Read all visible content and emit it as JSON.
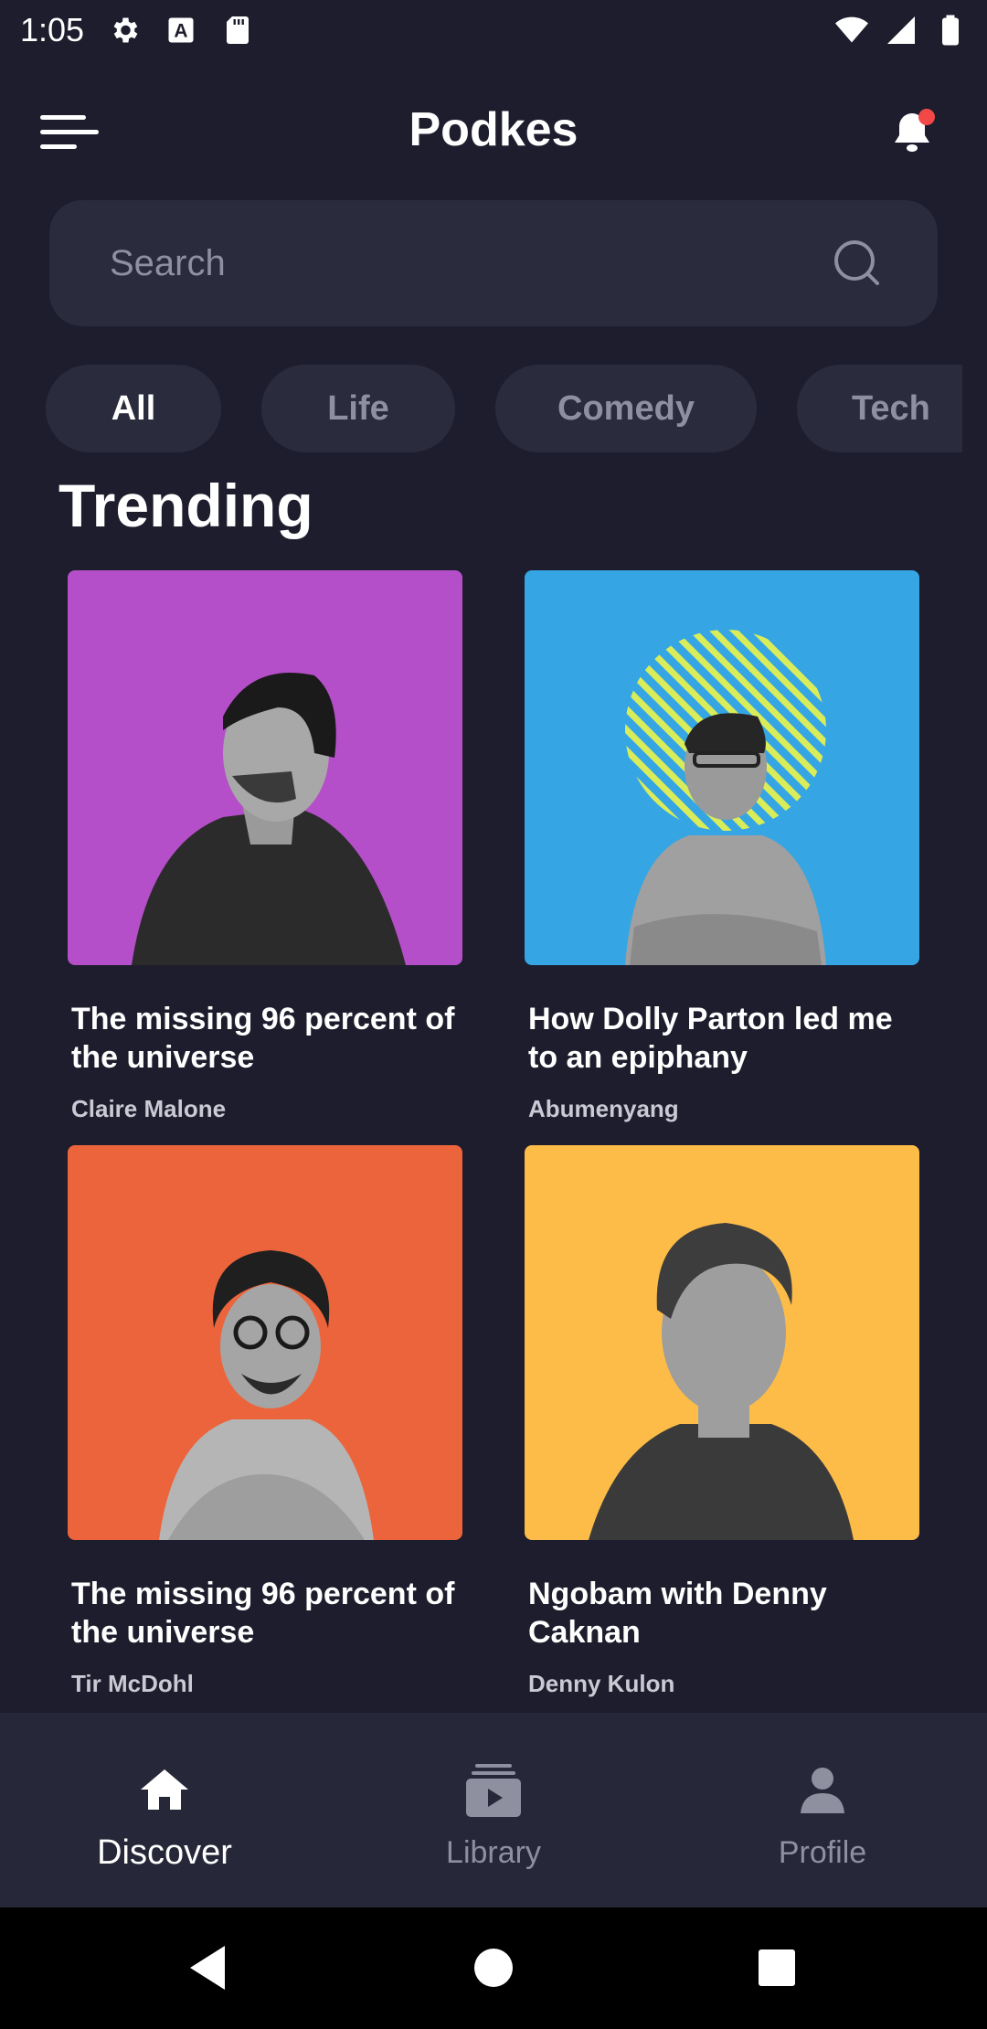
{
  "status_bar": {
    "time": "1:05",
    "icons_left": [
      "gear-icon",
      "a-badge-icon",
      "sd-card-icon"
    ],
    "icons_right": [
      "wifi-icon",
      "signal-icon",
      "battery-icon"
    ]
  },
  "header": {
    "title": "Podkes",
    "menu_icon": "menu-icon",
    "notification_icon": "bell-icon",
    "notification_badge_color": "#f24848"
  },
  "search": {
    "placeholder": "Search",
    "value": ""
  },
  "categories": {
    "items": [
      {
        "label": "All",
        "active": true
      },
      {
        "label": "Life",
        "active": false
      },
      {
        "label": "Comedy",
        "active": false
      },
      {
        "label": "Tech",
        "active": false
      }
    ]
  },
  "trending": {
    "title": "Trending",
    "cards": [
      {
        "title": "The missing 96 percent of the universe",
        "author": "Claire Malone",
        "bg_color": "#b54fc9"
      },
      {
        "title": "How Dolly Parton led me to an epiphany",
        "author": "Abumenyang",
        "bg_color": "#35a6e3"
      },
      {
        "title": "The missing 96 percent of the universe",
        "author": "Tir McDohl",
        "bg_color": "#ec643b"
      },
      {
        "title": "Ngobam with Denny Caknan",
        "author": "Denny Kulon",
        "bg_color": "#fdbc48"
      }
    ]
  },
  "bottom_nav": {
    "items": [
      {
        "label": "Discover",
        "icon": "home-icon",
        "active": true
      },
      {
        "label": "Library",
        "icon": "library-icon",
        "active": false
      },
      {
        "label": "Profile",
        "icon": "profile-icon",
        "active": false
      }
    ]
  },
  "colors": {
    "background": "#1d1d2d",
    "surface": "#2a2b3d",
    "nav_background": "#262738",
    "muted_text": "#8e90a0"
  }
}
